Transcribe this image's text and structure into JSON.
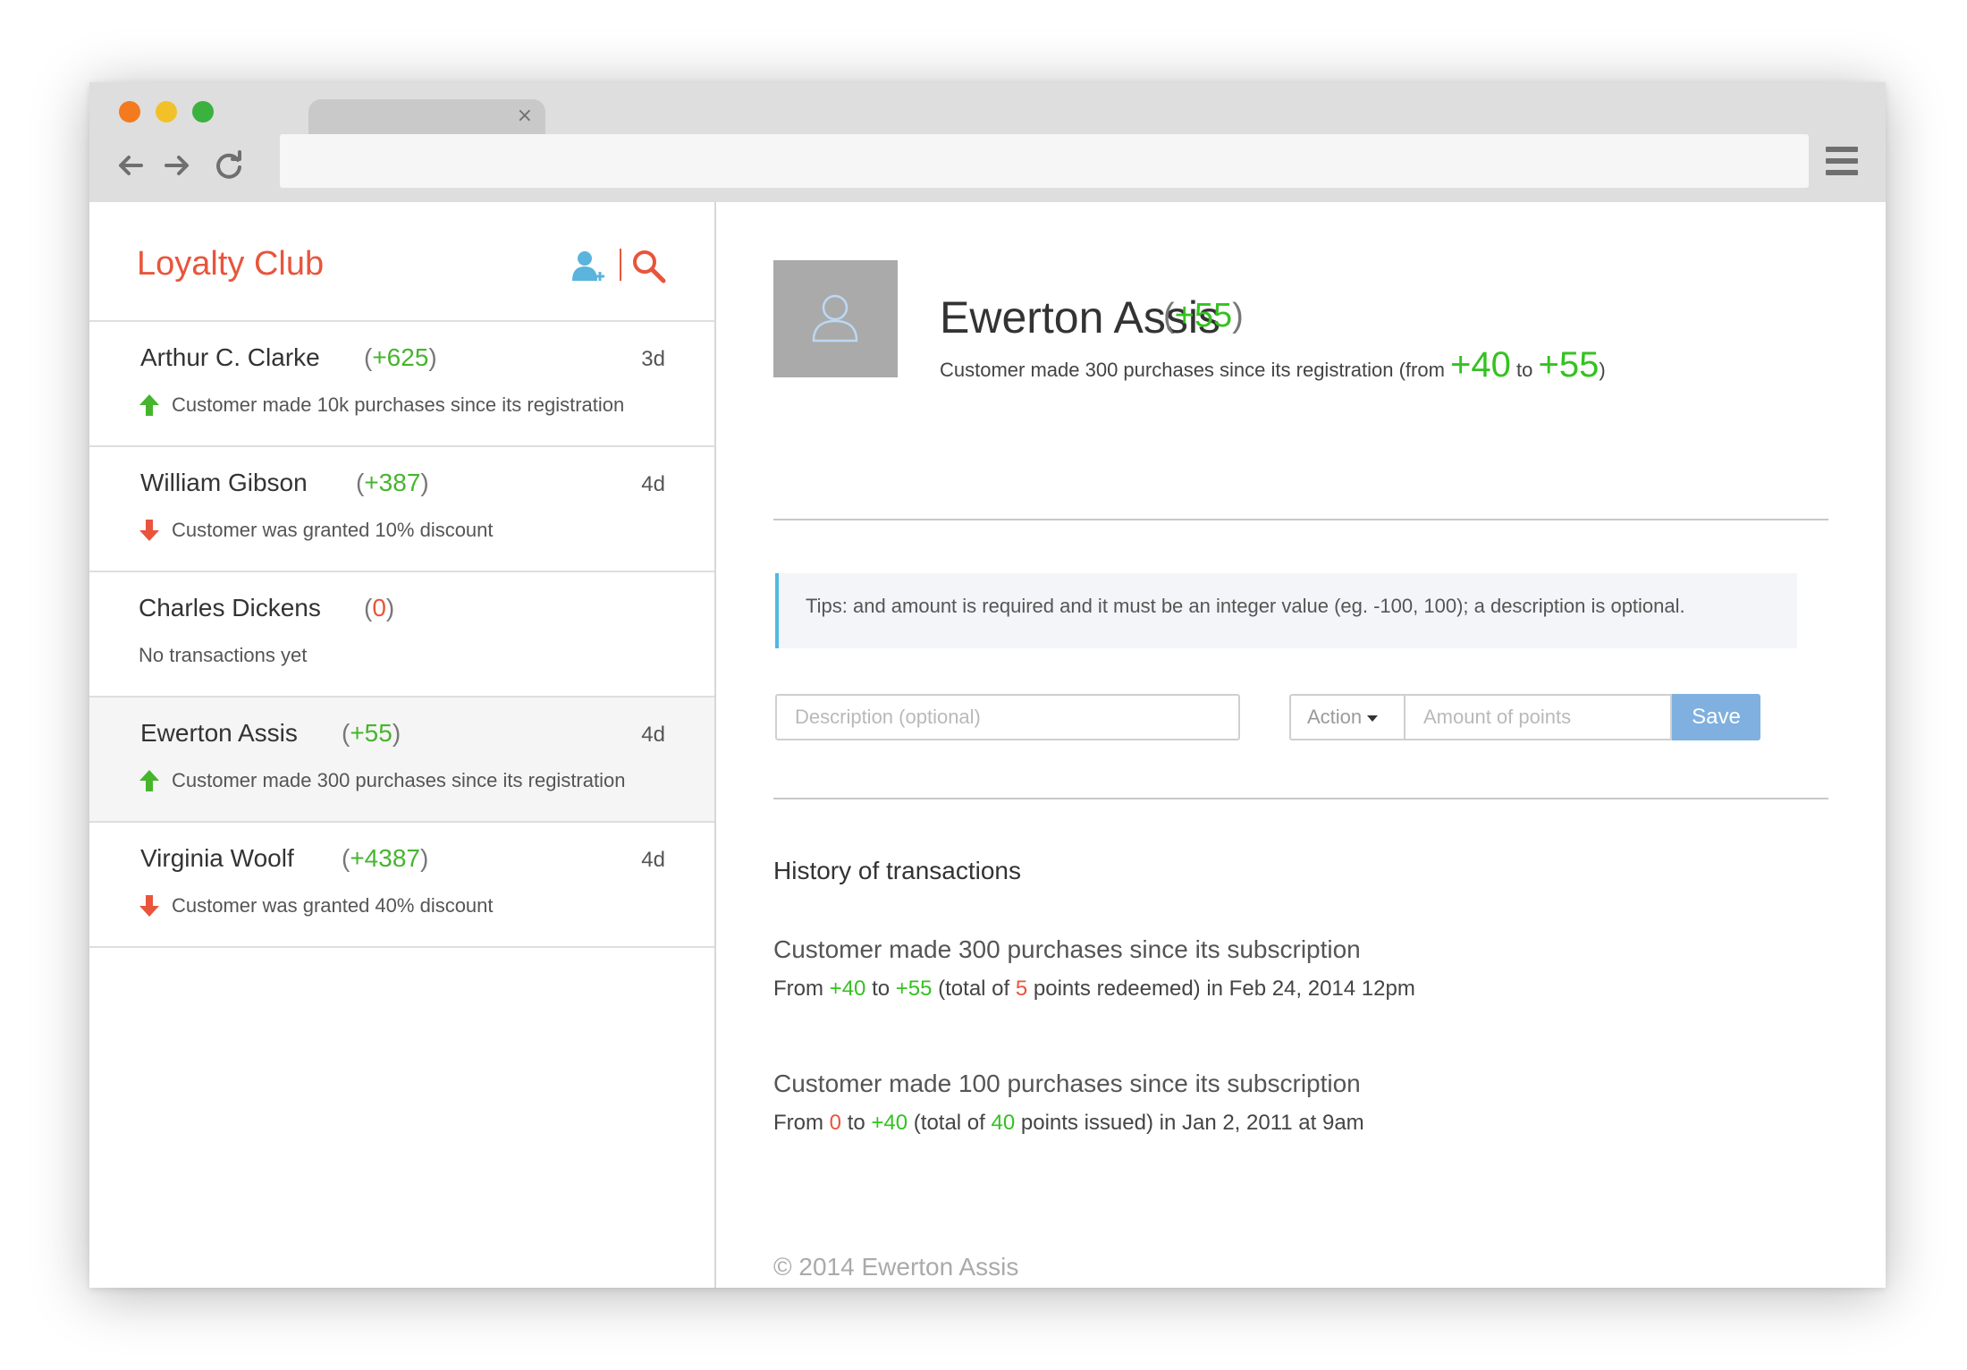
{
  "browser": {
    "tab_close": "×",
    "address": ""
  },
  "sidebar": {
    "title": "Loyalty Club",
    "contacts": [
      {
        "name": "Arthur C. Clarke",
        "delta": "+625",
        "age": "3d",
        "trend": "up",
        "description": "Customer made 10k purchases since its registration"
      },
      {
        "name": "William Gibson",
        "delta": "+387",
        "age": "4d",
        "trend": "down",
        "description": "Customer was granted 10% discount"
      },
      {
        "name": "Charles Dickens",
        "delta": "0",
        "age": "",
        "trend": "none",
        "description": "No transactions yet"
      },
      {
        "name": "Ewerton Assis",
        "delta": "+55",
        "age": "4d",
        "trend": "up",
        "description": "Customer made 300 purchases since its registration"
      },
      {
        "name": "Virginia Woolf",
        "delta": "+4387",
        "age": "4d",
        "trend": "down",
        "description": "Customer was granted 40% discount"
      }
    ]
  },
  "profile": {
    "name": "Ewerton Assis",
    "delta": "+55",
    "description_prefix": "Customer made 300 purchases since its registration (from",
    "from_value": "+40",
    "to_word": "to",
    "to_value": "+55",
    "description_suffix": ")"
  },
  "tips": {
    "text": "Tips: and amount is required and it must be an integer value (eg. -100, 100); a description is optional."
  },
  "form": {
    "description_placeholder": "Description (optional)",
    "action_label": "Action",
    "amount_placeholder": "Amount of points",
    "save_label": "Save"
  },
  "history": {
    "title": "History of transactions",
    "transactions": [
      {
        "title": "Customer made 300 purchases since its subscription",
        "from_word": "From",
        "from_value": "+40",
        "to_word": "to",
        "to_value": "+55",
        "total_prefix": "(total of",
        "total_value": "5",
        "total_suffix": "points redeemed) in Feb 24, 2014 12pm"
      },
      {
        "title": "Customer made 100 purchases since its subscription",
        "from_word": "From",
        "from_value": "0",
        "to_word": "to",
        "to_value": "+40",
        "total_prefix": " (total of",
        "total_value": "40",
        "total_suffix": "points issued) in Jan 2, 2011 at 9am"
      }
    ]
  },
  "footer": {
    "copyright": "© 2014 Ewerton Assis"
  },
  "colors": {
    "brand": "#e8553c",
    "positive": "#34c221",
    "save": "#7fb0df",
    "tips_border": "#4fb9e3"
  }
}
